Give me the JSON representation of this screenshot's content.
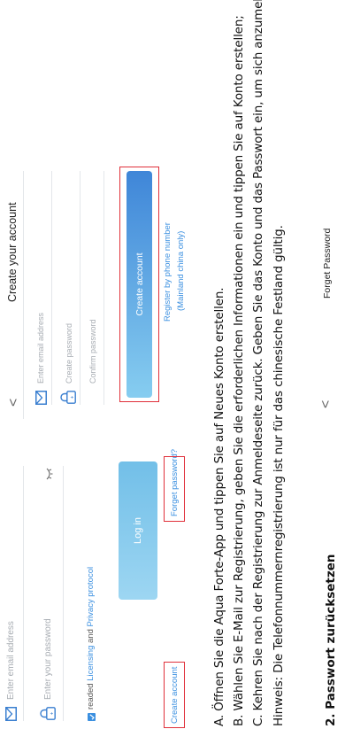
{
  "login_screen": {
    "email_placeholder": "Enter email address",
    "password_placeholder": "Enter your password",
    "agreement_prefix": "readed ",
    "licensing_link": "Licensing",
    "agreement_and": " and ",
    "privacy_link": "Privacy protocol",
    "login_button": "Log in",
    "create_account_link": "Create account",
    "forget_password_link": "Forget password?"
  },
  "register_screen": {
    "back_symbol": "<",
    "title": "Create your account",
    "email_placeholder": "Enter email address",
    "password_placeholder": "Create password",
    "confirm_placeholder": "Confirm password",
    "create_button": "Create account",
    "phone_link": "Register by phone number",
    "phone_note": "(Mainland china only)"
  },
  "instructions": {
    "step_a": "A. Öffnen Sie die Aqua Forte-App und tippen Sie auf Neues Konto erstellen.",
    "step_b": "B. Wählen Sie E-Mail zur Registrierung, geben Sie die erforderlichen Informationen ein und tippen Sie auf Konto erstellen;",
    "step_c": "C. Kehren Sie nach der Registrierung zur Anmeldeseite zurück. Geben Sie das Konto und das Passwort ein, um sich anzumelden",
    "hint": "Hinweis: Die Telefonnummernregistrierung ist nur für das chinesische Festland gültig."
  },
  "section_heading": "2. Passwort zurücksetzen",
  "forget_screen": {
    "back_symbol": "<",
    "title": "Forget Password"
  },
  "colors": {
    "accent_blue": "#3a8fe0",
    "highlight_red": "#e0303a",
    "login_button_start": "#8fd0ef",
    "login_button_end": "#6bbbe6",
    "create_button_start": "#7ec8ee",
    "create_button_end": "#3f86d8"
  }
}
